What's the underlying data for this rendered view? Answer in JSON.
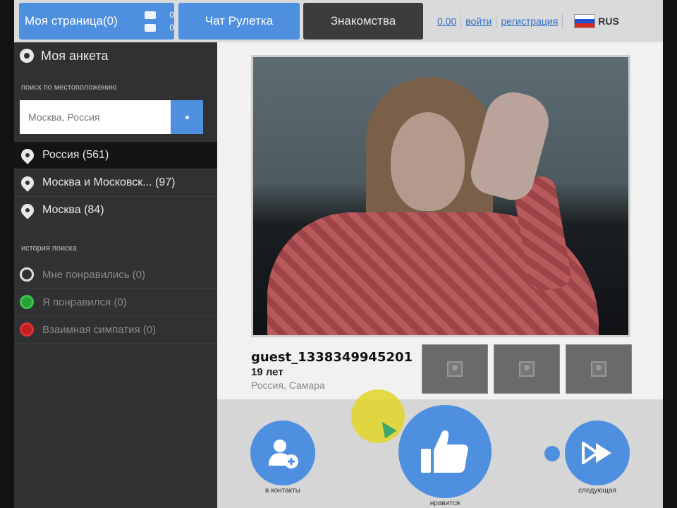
{
  "topbar": {
    "my_page_label": "Моя страница(0)",
    "friends_count": "0",
    "messages_count": "0",
    "roulette_label": "Чат Рулетка",
    "dating_label": "Знакомства",
    "balance": "0.00",
    "login_label": "войти",
    "register_label": "регистрация",
    "language": "RUS"
  },
  "sidebar": {
    "header": "Моя анкета",
    "location_section_title": "поиск по местоположению",
    "location_value": "Москва, Россия",
    "locations": [
      {
        "label": "Россия (561)"
      },
      {
        "label": "Москва и Московск... (97)"
      },
      {
        "label": "Москва (84)"
      }
    ],
    "history_title": "история поиска",
    "history": [
      {
        "label": "Мне понравились (0)",
        "color": "#e0e0e0"
      },
      {
        "label": "Я понравился (0)",
        "color": "#3ec24a"
      },
      {
        "label": "Взаимная симпатия (0)",
        "color": "#e03030"
      }
    ]
  },
  "profile": {
    "name": "guest_1338349945201",
    "age": "19 лет",
    "location": "Россия, Самара"
  },
  "actions": {
    "contacts_label": "в контакты",
    "like_label": "нравится",
    "next_label": "следующая"
  },
  "colors": {
    "accent": "#4f8fe0",
    "sidebar_bg": "#2f3133"
  }
}
